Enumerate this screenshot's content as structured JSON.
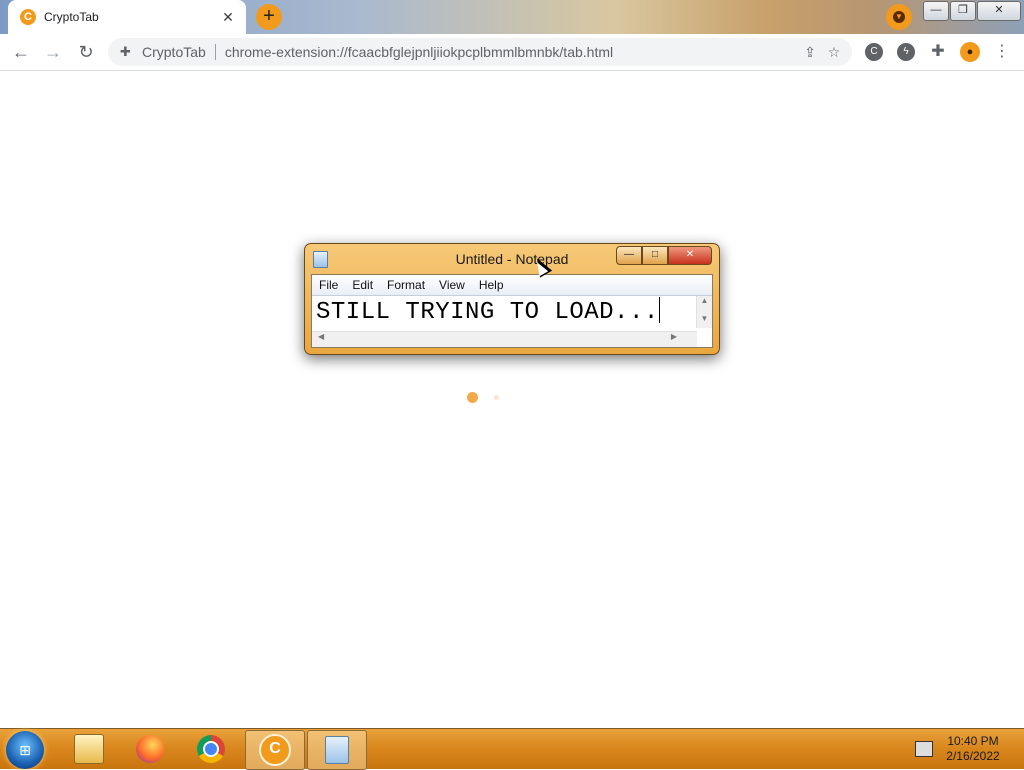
{
  "browser": {
    "tab": {
      "title": "CryptoTab",
      "favicon": "cryptotab-icon"
    },
    "new_tab": "+",
    "omnibox": {
      "site_name": "CryptoTab",
      "url": "chrome-extension://fcaacbfglejpnljiiokpcplbmmlbmnbk/tab.html"
    },
    "window_controls": {
      "minimize": "—",
      "restore": "❐",
      "close": "✕"
    }
  },
  "notepad": {
    "title": "Untitled - Notepad",
    "menu": [
      "File",
      "Edit",
      "Format",
      "View",
      "Help"
    ],
    "text": "STILL TRYING TO LOAD...",
    "controls": {
      "minimize": "—",
      "maximize": "□",
      "close": "✕"
    }
  },
  "taskbar": {
    "apps": [
      "windows-explorer-icon",
      "firefox-icon",
      "chrome-icon",
      "cryptotab-icon",
      "notepad-icon"
    ],
    "clock": {
      "time": "10:40 PM",
      "date": "2/16/2022"
    }
  },
  "colors": {
    "accent": "#f29a1c",
    "notepad_frame": "#e9a640",
    "taskbar": "#d8861c"
  }
}
